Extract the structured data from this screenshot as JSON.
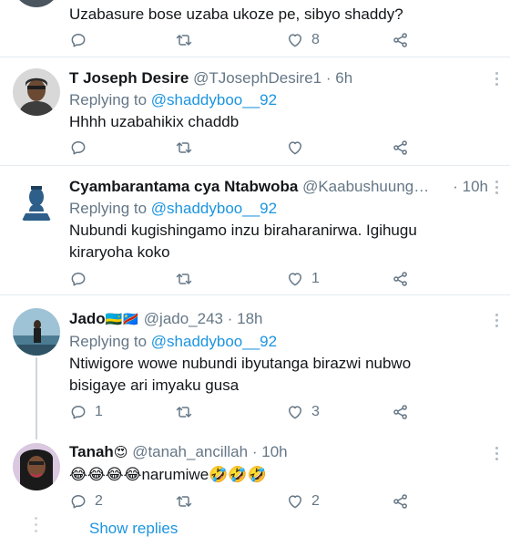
{
  "tweets": [
    {
      "text": "Uzabasure bose uzaba ukoze pe, sibyo shaddy?",
      "actions": {
        "replies": "",
        "retweets": "",
        "likes": "8"
      }
    },
    {
      "name": "T Joseph Desire",
      "handle": "@TJosephDesire1",
      "time": "6h",
      "replying_prefix": "Replying to",
      "replying_to": "@shaddyboo__92",
      "text": "Hhhh uzabahikix chaddb",
      "actions": {
        "replies": "",
        "retweets": "",
        "likes": ""
      }
    },
    {
      "name": "Cyambarantama cya Ntabwoba",
      "handle": "@Kaabushuung…",
      "time": "10h",
      "replying_prefix": "Replying to",
      "replying_to": "@shaddyboo__92",
      "text_line1": "Nubundi kugishingamo inzu biraharanirwa.  Igihugu",
      "text_line2": "kiraryoha koko",
      "actions": {
        "replies": "",
        "retweets": "",
        "likes": "1"
      }
    },
    {
      "name": "Jado",
      "name_emojis": "🇷🇼🇨🇩",
      "handle": "@jado_243",
      "time": "18h",
      "replying_prefix": "Replying to",
      "replying_to": "@shaddyboo__92",
      "text_line1": "Ntiwigore wowe nubundi ibyutanga birazwi nubwo",
      "text_line2": "bisigaye ari imyaku gusa",
      "actions": {
        "replies": "1",
        "retweets": "",
        "likes": "3"
      }
    },
    {
      "name": "Tanah",
      "name_emojis": "😍",
      "handle": "@tanah_ancillah",
      "time": "10h",
      "text": "😂😂😂😂narumiwe🤣🤣🤣",
      "actions": {
        "replies": "2",
        "retweets": "",
        "likes": "2"
      }
    }
  ],
  "show_replies": "Show replies",
  "separator_dot": "·",
  "icons": {
    "reply": "reply-icon",
    "retweet": "retweet-icon",
    "like": "heart-icon",
    "share": "share-icon",
    "more": "more-vertical-icon"
  },
  "colors": {
    "link": "#1b95e0",
    "muted": "#657786",
    "divider": "#e6ecf0"
  }
}
